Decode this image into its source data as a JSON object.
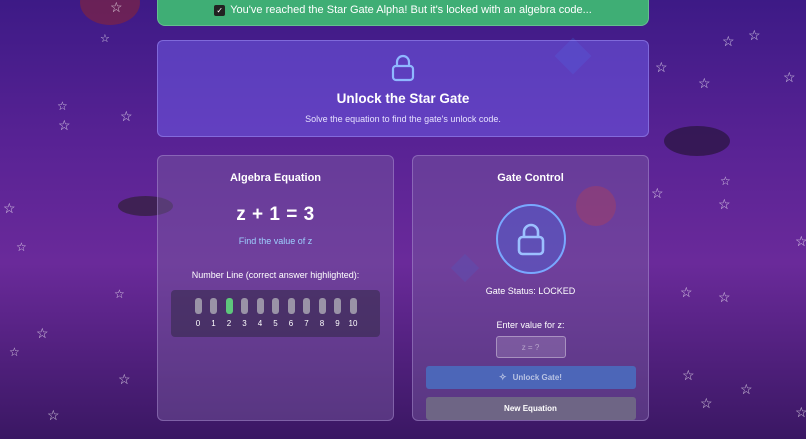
{
  "banner": {
    "check_icon": "✓",
    "text": "You've reached the Star Gate Alpha! But it's locked with an algebra code..."
  },
  "hero": {
    "icon": "lock-icon",
    "title": "Unlock the Star Gate",
    "subtitle": "Solve the equation to find the gate's unlock code."
  },
  "equation_panel": {
    "title": "Algebra Equation",
    "equation": "z + 1 = 3",
    "hint": "Find the value of z",
    "number_line_title": "Number Line (correct answer highlighted):",
    "number_line": [
      "0",
      "1",
      "2",
      "3",
      "4",
      "5",
      "6",
      "7",
      "8",
      "9",
      "10"
    ],
    "highlighted": "2"
  },
  "gate_panel": {
    "title": "Gate Control",
    "icon": "lock-icon",
    "status": "Gate Status: LOCKED",
    "input_label": "Enter value for z:",
    "input_placeholder": "z = ?",
    "input_value": "",
    "unlock_icon": "✧",
    "unlock_label": "Unlock Gate!",
    "new_label": "New Equation"
  },
  "colors": {
    "accent": "#79a8ff",
    "success": "#3fae75",
    "highlight": "#5ec77c"
  }
}
